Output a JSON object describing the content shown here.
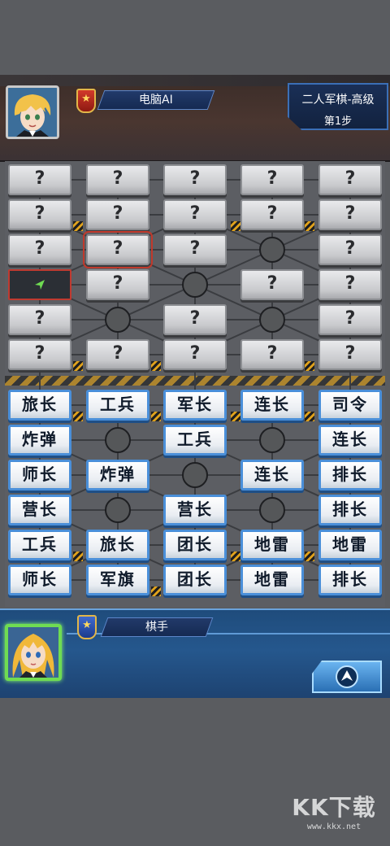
{
  "opponent": {
    "name": "电脑AI",
    "avatar_icon": "anime-boy-avatar-icon",
    "rank_icon": "star-rank-badge-icon"
  },
  "game_info": {
    "title": "二人军棋-高级",
    "step": "第1步"
  },
  "player": {
    "name": "棋手",
    "avatar_icon": "anime-girl-avatar-icon",
    "rank_icon": "star-rank-badge-icon",
    "action_icon": "arrow-up-icon"
  },
  "opponent_board": {
    "hidden_label": "?",
    "selected_cell": "r3c2",
    "empty_cell": "r4c1"
  },
  "player_pieces": {
    "r1": [
      "旅长",
      "工兵",
      "军长",
      "连长",
      "司令"
    ],
    "r2": [
      "炸弹",
      "",
      "工兵",
      "",
      "连长"
    ],
    "r3": [
      "师长",
      "炸弹",
      "",
      "连长",
      "排长"
    ],
    "r4": [
      "营长",
      "",
      "营长",
      "",
      "排长"
    ],
    "r5": [
      "工兵",
      "旅长",
      "团长",
      "地雷",
      "地雷"
    ],
    "r6": [
      "师长",
      "军旗",
      "团长",
      "地雷",
      "排长"
    ]
  },
  "colors": {
    "accent_blue": "#4a8fd9",
    "selected_red": "#c0392b",
    "player_glow": "#6fdc52",
    "hazard_orange": "#e0a21c"
  },
  "watermark": {
    "logo": "KK下载",
    "url": "www.kkx.net"
  }
}
